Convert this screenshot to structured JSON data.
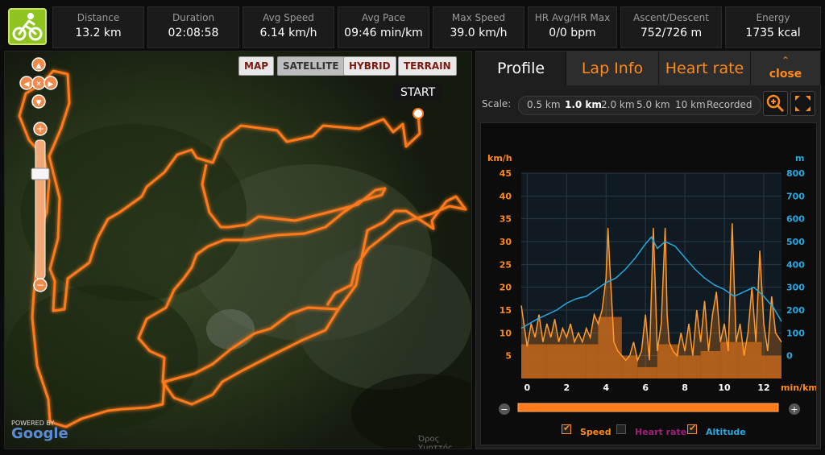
{
  "header": {
    "stats": [
      {
        "label": "Distance",
        "value": "13.2 km"
      },
      {
        "label": "Duration",
        "value": "02:08:58"
      },
      {
        "label": "Avg Speed",
        "value": "6.14 km/h"
      },
      {
        "label": "Avg Pace",
        "value": "09:46 min/km"
      },
      {
        "label": "Max Speed",
        "value": "39.0 km/h"
      },
      {
        "label": "HR Avg/HR Max",
        "value": "0/0 bpm"
      },
      {
        "label": "Ascent/Descent",
        "value": "752/726 m"
      },
      {
        "label": "Energy",
        "value": "1735 kcal"
      }
    ]
  },
  "map": {
    "types": [
      "MAP",
      "SATELLITE",
      "HYBRID",
      "TERRAIN"
    ],
    "active_type": "SATELLITE",
    "start_label": "START",
    "powered_by": "POWERED BY",
    "google": "Google",
    "place_label": "Όρος Υμηττός"
  },
  "panel": {
    "tabs": [
      "Profile",
      "Lap Info",
      "Heart rate"
    ],
    "close_label": "close",
    "scale_label": "Scale:",
    "scale_options": [
      "0.5 km",
      "1.0 km",
      "2.0 km",
      "5.0 km",
      "10 km",
      "Recorded"
    ],
    "active_scale": "1.0 km",
    "legend": [
      {
        "label": "Speed",
        "checked": true,
        "color": "#ff8a1c"
      },
      {
        "label": "Heart rate",
        "checked": false,
        "color": "#a0207a"
      },
      {
        "label": "Altitude",
        "checked": true,
        "color": "#2aa8e0"
      }
    ]
  },
  "chart_data": {
    "type": "line",
    "left_unit": "km/h",
    "right_unit": "m",
    "x_unit": "min/km",
    "x_ticks": [
      0,
      2,
      4,
      6,
      8,
      10,
      12
    ],
    "left_ticks": [
      5,
      10,
      15,
      20,
      25,
      30,
      35,
      40,
      45
    ],
    "right_ticks": [
      0,
      100,
      200,
      300,
      400,
      500,
      600,
      700,
      800
    ],
    "xlim": [
      -0.3,
      12.9
    ],
    "left_ylim": [
      0,
      45
    ],
    "right_ylim": [
      -100,
      800
    ],
    "bars": [
      {
        "x0": -0.3,
        "x1": 1.0,
        "value": 7.5
      },
      {
        "x0": 1.0,
        "x1": 2.0,
        "value": 7.5
      },
      {
        "x0": 2.0,
        "x1": 3.0,
        "value": 7.5
      },
      {
        "x0": 3.0,
        "x1": 3.6,
        "value": 7.5
      },
      {
        "x0": 3.6,
        "x1": 4.0,
        "value": 13.5
      },
      {
        "x0": 4.0,
        "x1": 4.8,
        "value": 13.5
      },
      {
        "x0": 4.8,
        "x1": 5.6,
        "value": 5.0
      },
      {
        "x0": 5.6,
        "x1": 6.6,
        "value": 2.5
      },
      {
        "x0": 6.6,
        "x1": 7.7,
        "value": 7.5
      },
      {
        "x0": 7.7,
        "x1": 8.8,
        "value": 5.0
      },
      {
        "x0": 8.8,
        "x1": 9.8,
        "value": 6.0
      },
      {
        "x0": 9.8,
        "x1": 10.7,
        "value": 8.0
      },
      {
        "x0": 10.7,
        "x1": 11.9,
        "value": 8.0
      },
      {
        "x0": 11.9,
        "x1": 12.9,
        "value": 5.0
      }
    ],
    "series": [
      {
        "name": "Speed",
        "x": [
          -0.3,
          0.0,
          0.2,
          0.4,
          0.6,
          0.8,
          1.0,
          1.2,
          1.4,
          1.6,
          1.8,
          2.0,
          2.2,
          2.4,
          2.6,
          2.8,
          3.0,
          3.2,
          3.4,
          3.6,
          3.8,
          4.0,
          4.1,
          4.2,
          4.3,
          4.4,
          4.6,
          4.8,
          5.0,
          5.2,
          5.4,
          5.6,
          5.8,
          6.0,
          6.2,
          6.4,
          6.5,
          6.6,
          6.8,
          7.0,
          7.1,
          7.2,
          7.4,
          7.6,
          7.8,
          8.0,
          8.2,
          8.4,
          8.6,
          8.8,
          9.0,
          9.2,
          9.4,
          9.6,
          9.8,
          10.0,
          10.2,
          10.4,
          10.6,
          10.8,
          11.0,
          11.2,
          11.4,
          11.6,
          11.8,
          12.0,
          12.2,
          12.4,
          12.6,
          12.9
        ],
        "values": [
          16,
          7,
          12,
          9,
          14,
          8,
          12,
          9,
          13,
          8,
          11,
          9,
          12,
          8,
          10,
          8,
          11,
          9,
          14,
          12,
          15,
          22,
          33,
          24,
          16,
          8,
          6,
          5,
          4,
          5,
          8,
          4,
          6,
          14,
          4,
          33,
          20,
          6,
          12,
          33,
          14,
          8,
          6,
          5,
          10,
          6,
          12,
          5,
          15,
          8,
          17,
          6,
          14,
          19,
          8,
          12,
          6,
          34,
          8,
          12,
          5,
          10,
          20,
          8,
          28,
          12,
          6,
          18,
          10,
          8
        ]
      },
      {
        "name": "Altitude",
        "x": [
          -0.3,
          0.5,
          1.0,
          1.5,
          2.0,
          2.5,
          3.0,
          3.5,
          4.0,
          4.5,
          5.0,
          5.5,
          6.0,
          6.3,
          6.6,
          7.0,
          7.5,
          8.0,
          8.5,
          9.0,
          9.5,
          10.0,
          10.5,
          11.0,
          11.5,
          12.0,
          12.5,
          12.9
        ],
        "values": [
          120,
          160,
          180,
          200,
          230,
          250,
          260,
          290,
          320,
          340,
          380,
          430,
          490,
          520,
          470,
          500,
          480,
          430,
          380,
          340,
          310,
          290,
          260,
          280,
          300,
          260,
          210,
          150
        ]
      }
    ]
  }
}
